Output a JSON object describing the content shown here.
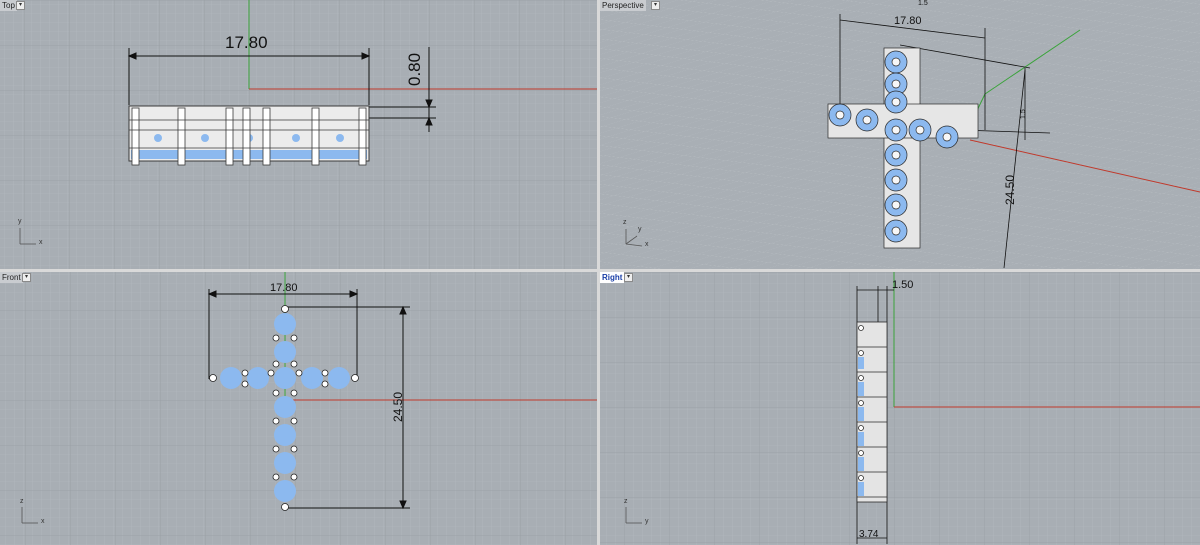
{
  "viewports": {
    "top": {
      "label": "Top",
      "dim_width": "17.80",
      "dim_depth": "0.80",
      "axis_v": "y",
      "axis_h": "x"
    },
    "perspective": {
      "label": "Perspective",
      "dim_width": "17.80",
      "dim_height": "24.50",
      "dim_small_1": "1.5",
      "dim_small_2": "1.5",
      "axis_v": "z",
      "axis_h": "x",
      "axis_d": "y"
    },
    "front": {
      "label": "Front",
      "dim_width": "17.80",
      "dim_height": "24.50",
      "axis_v": "z",
      "axis_h": "x"
    },
    "right": {
      "label": "Right",
      "dim_top": "1.50",
      "dim_bottom": "3.74",
      "axis_v": "z",
      "axis_h": "y"
    }
  },
  "menu_glyph": "▾",
  "colors": {
    "viewport_bg": "#a8aeb4",
    "grid_minor": "#b5bac0",
    "grid_major": "#9aa0a6",
    "x_axis": "#c0392b",
    "y_axis": "#3aa33a",
    "gem": "#8cb9ef",
    "metal": "#e8e8e8",
    "active_label": "#1a3fa8"
  }
}
